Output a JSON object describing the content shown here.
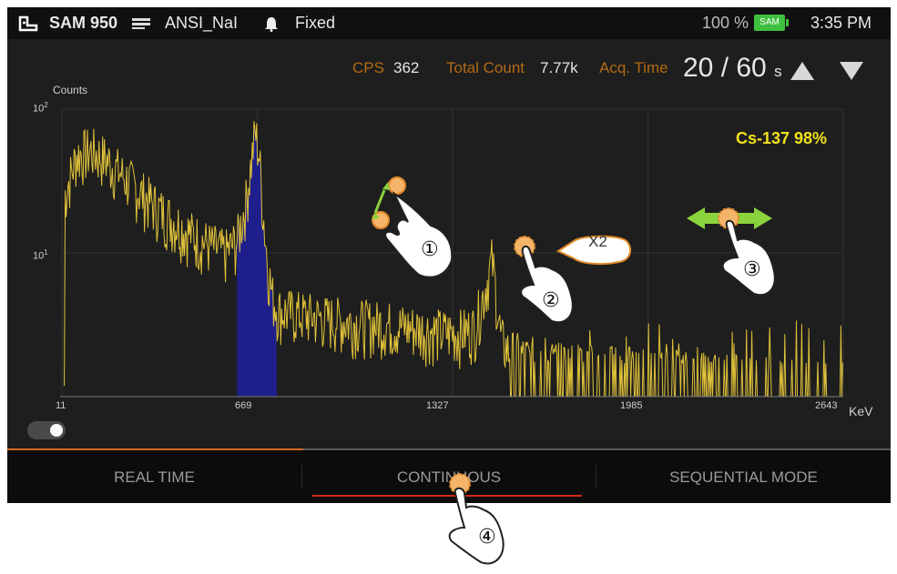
{
  "status_bar": {
    "device": "SAM 950",
    "detector": "ANSI_NaI",
    "mode": "Fixed",
    "battery_percent": "100 %",
    "battery_label": "SAM",
    "time": "3:35 PM"
  },
  "stats": {
    "cps_label": "CPS",
    "cps_value": "362",
    "total_count_label": "Total Count",
    "total_count_value": "7.77k",
    "acq_time_label": "Acq. Time",
    "acq_time_value": "20 / 60",
    "acq_time_unit": "s"
  },
  "chart": {
    "y_label": "Counts",
    "x_unit": "KeV",
    "y_ticks": [
      "10",
      "10"
    ],
    "y_tick_exponents": [
      "2",
      "1"
    ],
    "x_ticks": [
      "11",
      "669",
      "1327",
      "1985",
      "2643"
    ],
    "identification": "Cs-137  98%"
  },
  "chart_data": {
    "type": "line",
    "xlabel": "KeV",
    "ylabel": "Counts",
    "y_scale": "log",
    "xlim": [
      11,
      2643
    ],
    "x_ticks": [
      11,
      669,
      1327,
      1985,
      2643
    ],
    "y_ticks": [
      10,
      100
    ],
    "grid": true,
    "line_color": "#e0c23a",
    "roi_fill_color": "#1f1f8c",
    "roi_x_range": [
      600,
      735
    ],
    "annotation": "Cs-137 98%",
    "series": [
      {
        "x": [
          20,
          60,
          110,
          160,
          220,
          280,
          340,
          400,
          460,
          520,
          560,
          600,
          630,
          650,
          662,
          675,
          690,
          705,
          720,
          740,
          800,
          900,
          1000,
          1100,
          1200,
          1300,
          1350,
          1400,
          1440,
          1460,
          1475,
          1490,
          1520,
          1600,
          1800,
          2000,
          2200,
          2400,
          2643
        ],
        "y": [
          25,
          48,
          52,
          45,
          34,
          26,
          20,
          16,
          13,
          11,
          10,
          12,
          22,
          45,
          70,
          50,
          18,
          8,
          5,
          4,
          3.8,
          3.5,
          3.3,
          3.2,
          3,
          2.8,
          2.8,
          3,
          6,
          9,
          5,
          2.5,
          2,
          1.8,
          1.6,
          1.5,
          1.4,
          1.3,
          1.2
        ]
      }
    ]
  },
  "gesture_hints": {
    "pinch_number": "①",
    "double_tap_number": "②",
    "double_tap_label": "X2",
    "pan_number": "③",
    "swipe_number": "④"
  },
  "tabs": [
    {
      "label": "REAL TIME"
    },
    {
      "label": "CONTINUOUS"
    },
    {
      "label": "SEQUENTIAL MODE"
    }
  ],
  "colors": {
    "accent": "#d2691e",
    "spectrum": "#e0c23a",
    "identification": "#f2e21a",
    "gesture_arrow": "#8bd33c"
  }
}
